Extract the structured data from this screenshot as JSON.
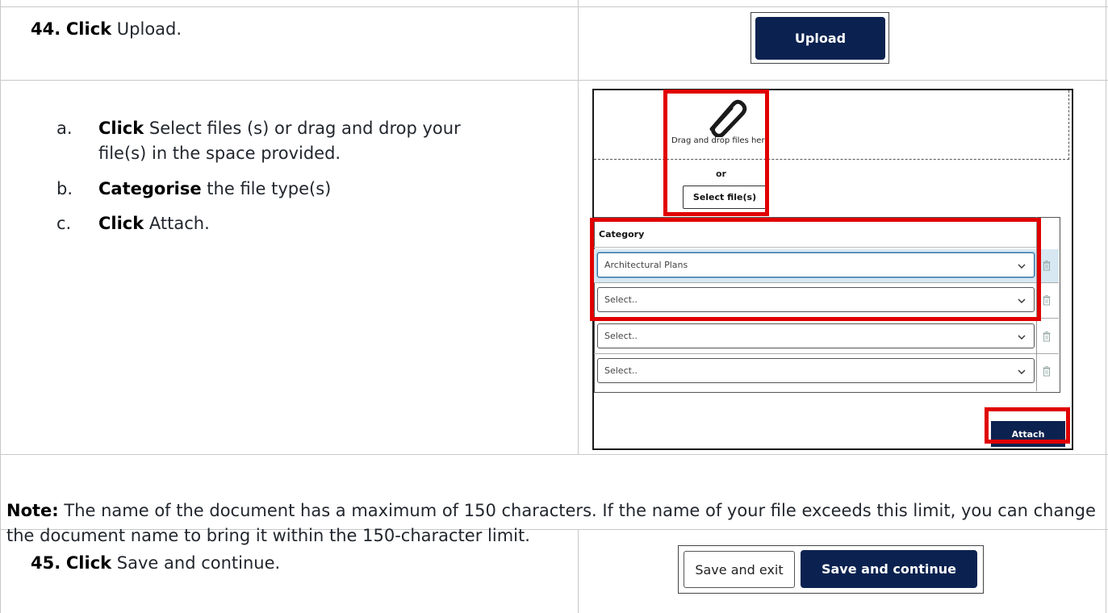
{
  "step44": {
    "number": "44.",
    "verb": "Click",
    "text": " Upload."
  },
  "substeps": [
    {
      "letter": "a.",
      "verb": "Click",
      "text": " Select files (s) or drag and drop your",
      "text2": "file(s) in the space provided."
    },
    {
      "letter": "b.",
      "verb": "Categorise",
      "text": " the file type(s)"
    },
    {
      "letter": "c.",
      "verb": "Click",
      "text": " Attach."
    }
  ],
  "upload_shot": {
    "button_label": "Upload"
  },
  "file_panel": {
    "drop_text": "Drag and drop files here",
    "or_text": "or",
    "select_files_label": "Select file(s)",
    "category_header": "Category",
    "rows": [
      {
        "value": "Architectural Plans",
        "selected": true
      },
      {
        "value": "Select..",
        "selected": false
      },
      {
        "value": "Select..",
        "selected": false
      },
      {
        "value": "Select..",
        "selected": false
      }
    ],
    "attach_label": "Attach"
  },
  "note": {
    "label": "Note:",
    "text": " The name of the document has a maximum of 150 characters. If the name of your file exceeds this limit, you can change the document name to bring it within the 150-character limit."
  },
  "step45": {
    "number": "45.",
    "verb": "Click",
    "text": " Save and continue."
  },
  "save_shot": {
    "save_exit_label": "Save and exit",
    "save_continue_label": "Save and continue"
  },
  "colors": {
    "navy": "#0b2250",
    "highlight": "#e00000",
    "selected_row": "#d7e8f3"
  },
  "icons": [
    "paperclip-icon",
    "chevron-down-icon",
    "trash-icon"
  ]
}
